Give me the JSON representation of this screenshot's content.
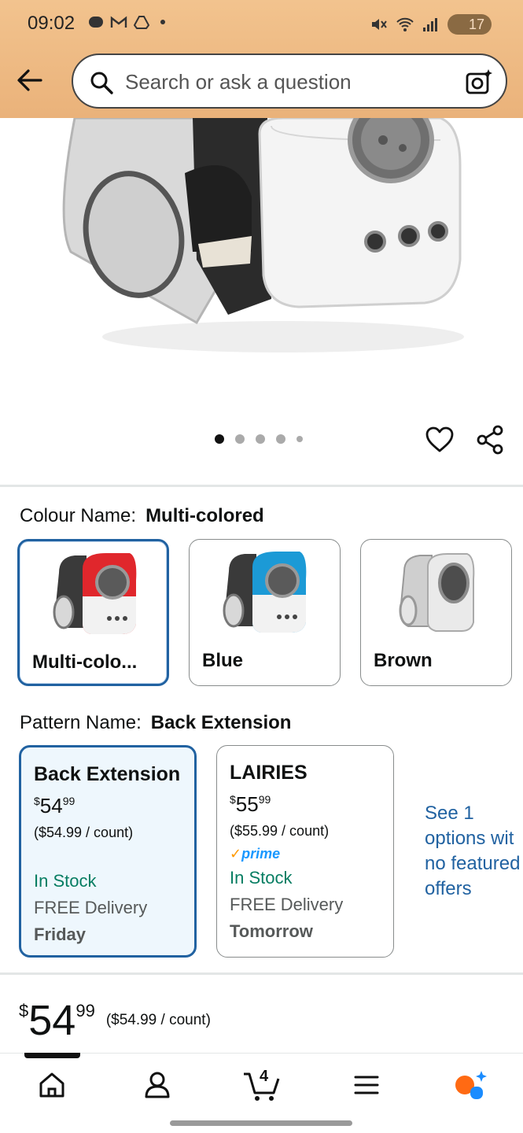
{
  "status_bar": {
    "time": "09:02",
    "battery": "17",
    "left_icons": [
      "weibo-icon",
      "gmail-icon",
      "drive-icon"
    ],
    "right_icons": [
      "mute-icon",
      "wifi-icon",
      "signal-icon"
    ]
  },
  "search": {
    "placeholder": "Search or ask a question"
  },
  "gallery": {
    "image_count": 5,
    "active_index": 0
  },
  "colour": {
    "label": "Colour Name:",
    "selected": "Multi-colored",
    "options": [
      {
        "label": "Multi-colo...",
        "accent": "#e0272c"
      },
      {
        "label": "Blue",
        "accent": "#1c9ad6"
      },
      {
        "label": "Brown",
        "accent": "#8b8b8b"
      }
    ]
  },
  "pattern": {
    "label": "Pattern Name:",
    "selected": "Back Extension",
    "options": [
      {
        "title": "Back Extension",
        "price_symbol": "$",
        "price_whole": "54",
        "price_cents": "99",
        "unit_price": "($54.99 / count)",
        "prime": false,
        "stock": "In Stock",
        "delivery": "FREE Delivery",
        "delivery_day": "Friday"
      },
      {
        "title": "LAIRIES",
        "price_symbol": "$",
        "price_whole": "55",
        "price_cents": "99",
        "unit_price": "($55.99 / count)",
        "prime": true,
        "prime_label": "prime",
        "stock": "In Stock",
        "delivery": "FREE Delivery",
        "delivery_day": "Tomorrow"
      }
    ],
    "see_options_lines": [
      "See 1",
      "options wit",
      "no featured",
      "offers"
    ]
  },
  "buy_box": {
    "price_symbol": "$",
    "price_whole": "54",
    "price_cents": "99",
    "unit_price": "($54.99 / count)"
  },
  "bottom_nav": {
    "items": [
      "home-icon",
      "account-icon",
      "cart-icon",
      "menu-icon",
      "rufus-icon"
    ],
    "cart_count": "4"
  },
  "colors": {
    "header_bg": "#eab27a",
    "selected_border": "#2162a1",
    "stock_green": "#067d62",
    "link_blue": "#2162a1",
    "prime_blue": "#1a98ff"
  }
}
